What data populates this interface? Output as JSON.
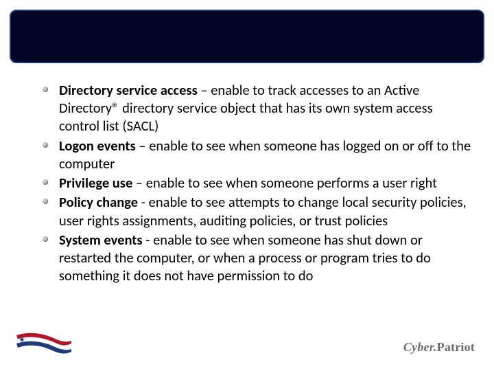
{
  "title": "",
  "bullets": [
    {
      "term": "Directory service access",
      "sep": " – ",
      "desc": "enable to track accesses to an Active Directory® directory service object that has its own system access control list (SACL)"
    },
    {
      "term": "Logon events",
      "sep": " – ",
      "desc": " enable to see when someone has logged on or off to the computer"
    },
    {
      "term": "Privilege use",
      "sep": " – ",
      "desc": " enable to see when someone performs a user right"
    },
    {
      "term": "Policy change",
      "sep": " - ",
      "desc": " enable to see attempts to change local security policies, user rights assignments, auditing policies, or trust policies"
    },
    {
      "term": "System events",
      "sep": " - ",
      "desc": "enable to see when someone has shut down or restarted the computer, or when a process or program tries to do something it does not have permission to do"
    }
  ],
  "footer": {
    "brand_a": "Cyber.",
    "brand_b": "Patriot"
  }
}
